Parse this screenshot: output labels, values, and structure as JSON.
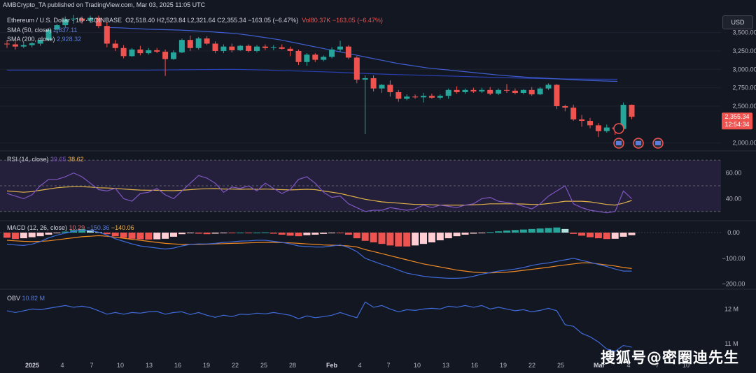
{
  "publish_line": "AMBCrypto_TA published on TradingView.com, Mar 03, 2025 11:05 UTC",
  "currency_button": "USD",
  "main_pane": {
    "symbol": "Ethereum / U.S. Dollar · 1D · COINBASE",
    "ohlc": "O2,518.40  H2,523.84  L2,321.64  C2,355.34  −163.05 (−6.47%)",
    "volume": "Vol80.37K  −163.05 (−6.47%)",
    "sma50_label": "SMA (50, close)",
    "sma50_value": "2,837.11",
    "sma200_label": "SMA (200, close)",
    "sma200_value": "2,928.32",
    "price_tag": "2,355.34",
    "countdown_tag": "12:54:34"
  },
  "rsi_pane": {
    "label": "RSI (14, close)",
    "value1": "39.65",
    "value2": "38.62"
  },
  "macd_pane": {
    "label": "MACD (12, 26, close)",
    "value1": "10.29",
    "value2": "−150.36",
    "value3": "−140.06"
  },
  "obv_pane": {
    "label": "OBV",
    "value": "10.82 M"
  },
  "watermark": "搜狐号@密圈迪先生",
  "colors": {
    "background": "#131722",
    "up": "#26a69a",
    "down": "#ef5350",
    "sma50": "#3f5fd1",
    "sma200": "#2a3fb0",
    "rsi": "#7e57c2",
    "rsi_ma": "#e0b34a",
    "macd": "#3f6ad8",
    "signal": "#f08a24",
    "obv": "#3f6ad8"
  },
  "chart_data": [
    {
      "type": "candlestick",
      "title": "Ethereum / U.S. Dollar · 1D · COINBASE",
      "y_ticks": [
        "3,500.00",
        "3,250.00",
        "3,000.00",
        "2,750.00",
        "2,500.00",
        "2,000.00"
      ],
      "ylim": [
        1930,
        3810
      ],
      "x_ticks": [
        "2025",
        "4",
        "7",
        "10",
        "13",
        "16",
        "19",
        "22",
        "25",
        "28",
        "Feb",
        "4",
        "7",
        "10",
        "13",
        "16",
        "19",
        "22",
        "25",
        "Mar",
        "4",
        "7",
        "10"
      ],
      "candles": [
        {
          "o": 3350,
          "h": 3400,
          "l": 3290,
          "c": 3340
        },
        {
          "o": 3340,
          "h": 3380,
          "l": 3270,
          "c": 3310
        },
        {
          "o": 3310,
          "h": 3360,
          "l": 3290,
          "c": 3330
        },
        {
          "o": 3330,
          "h": 3370,
          "l": 3300,
          "c": 3355
        },
        {
          "o": 3350,
          "h": 3420,
          "l": 3320,
          "c": 3400
        },
        {
          "o": 3400,
          "h": 3560,
          "l": 3390,
          "c": 3540
        },
        {
          "o": 3540,
          "h": 3620,
          "l": 3490,
          "c": 3600
        },
        {
          "o": 3600,
          "h": 3720,
          "l": 3560,
          "c": 3680
        },
        {
          "o": 3680,
          "h": 3740,
          "l": 3620,
          "c": 3690
        },
        {
          "o": 3690,
          "h": 3720,
          "l": 3620,
          "c": 3660
        },
        {
          "o": 3660,
          "h": 3730,
          "l": 3630,
          "c": 3700
        },
        {
          "o": 3700,
          "h": 3730,
          "l": 3560,
          "c": 3590
        },
        {
          "o": 3590,
          "h": 3640,
          "l": 3300,
          "c": 3350
        },
        {
          "o": 3350,
          "h": 3400,
          "l": 3250,
          "c": 3290
        },
        {
          "o": 3290,
          "h": 3330,
          "l": 3150,
          "c": 3180
        },
        {
          "o": 3180,
          "h": 3290,
          "l": 3170,
          "c": 3270
        },
        {
          "o": 3270,
          "h": 3320,
          "l": 3190,
          "c": 3220
        },
        {
          "o": 3220,
          "h": 3290,
          "l": 3200,
          "c": 3260
        },
        {
          "o": 3260,
          "h": 3290,
          "l": 3220,
          "c": 3240
        },
        {
          "o": 3240,
          "h": 3270,
          "l": 2910,
          "c": 3140
        },
        {
          "o": 3140,
          "h": 3260,
          "l": 3130,
          "c": 3230
        },
        {
          "o": 3230,
          "h": 3420,
          "l": 3220,
          "c": 3400
        },
        {
          "o": 3400,
          "h": 3460,
          "l": 3250,
          "c": 3290
        },
        {
          "o": 3290,
          "h": 3440,
          "l": 3270,
          "c": 3420
        },
        {
          "o": 3420,
          "h": 3450,
          "l": 3330,
          "c": 3350
        },
        {
          "o": 3350,
          "h": 3380,
          "l": 3220,
          "c": 3250
        },
        {
          "o": 3250,
          "h": 3340,
          "l": 3220,
          "c": 3310
        },
        {
          "o": 3310,
          "h": 3350,
          "l": 3230,
          "c": 3260
        },
        {
          "o": 3260,
          "h": 3330,
          "l": 3250,
          "c": 3320
        },
        {
          "o": 3320,
          "h": 3340,
          "l": 3230,
          "c": 3250
        },
        {
          "o": 3250,
          "h": 3330,
          "l": 3230,
          "c": 3310
        },
        {
          "o": 3310,
          "h": 3340,
          "l": 3260,
          "c": 3290
        },
        {
          "o": 3290,
          "h": 3330,
          "l": 3260,
          "c": 3300
        },
        {
          "o": 3300,
          "h": 3340,
          "l": 3270,
          "c": 3280
        },
        {
          "o": 3280,
          "h": 3310,
          "l": 3180,
          "c": 3250
        },
        {
          "o": 3250,
          "h": 3270,
          "l": 3060,
          "c": 3100
        },
        {
          "o": 3100,
          "h": 3220,
          "l": 3050,
          "c": 3200
        },
        {
          "o": 3200,
          "h": 3220,
          "l": 3100,
          "c": 3130
        },
        {
          "o": 3130,
          "h": 3190,
          "l": 3110,
          "c": 3170
        },
        {
          "o": 3170,
          "h": 3300,
          "l": 3150,
          "c": 3270
        },
        {
          "o": 3270,
          "h": 3390,
          "l": 3240,
          "c": 3310
        },
        {
          "o": 3310,
          "h": 3330,
          "l": 3140,
          "c": 3160
        },
        {
          "o": 3160,
          "h": 3180,
          "l": 2810,
          "c": 2860
        },
        {
          "o": 2860,
          "h": 2920,
          "l": 2120,
          "c": 2880
        },
        {
          "o": 2880,
          "h": 2920,
          "l": 2700,
          "c": 2740
        },
        {
          "o": 2740,
          "h": 2800,
          "l": 2680,
          "c": 2790
        },
        {
          "o": 2790,
          "h": 2850,
          "l": 2630,
          "c": 2690
        },
        {
          "o": 2690,
          "h": 2720,
          "l": 2560,
          "c": 2600
        },
        {
          "o": 2600,
          "h": 2660,
          "l": 2580,
          "c": 2630
        },
        {
          "o": 2630,
          "h": 2660,
          "l": 2600,
          "c": 2620
        },
        {
          "o": 2620,
          "h": 2680,
          "l": 2550,
          "c": 2640
        },
        {
          "o": 2640,
          "h": 2670,
          "l": 2600,
          "c": 2615
        },
        {
          "o": 2615,
          "h": 2660,
          "l": 2590,
          "c": 2640
        },
        {
          "o": 2640,
          "h": 2740,
          "l": 2600,
          "c": 2720
        },
        {
          "o": 2720,
          "h": 2770,
          "l": 2670,
          "c": 2690
        },
        {
          "o": 2690,
          "h": 2740,
          "l": 2670,
          "c": 2720
        },
        {
          "o": 2720,
          "h": 2750,
          "l": 2680,
          "c": 2700
        },
        {
          "o": 2700,
          "h": 2750,
          "l": 2680,
          "c": 2720
        },
        {
          "o": 2720,
          "h": 2760,
          "l": 2650,
          "c": 2670
        },
        {
          "o": 2670,
          "h": 2740,
          "l": 2650,
          "c": 2720
        },
        {
          "o": 2720,
          "h": 2800,
          "l": 2680,
          "c": 2710
        },
        {
          "o": 2710,
          "h": 2740,
          "l": 2660,
          "c": 2680
        },
        {
          "o": 2680,
          "h": 2730,
          "l": 2660,
          "c": 2720
        },
        {
          "o": 2720,
          "h": 2760,
          "l": 2640,
          "c": 2660
        },
        {
          "o": 2660,
          "h": 2760,
          "l": 2650,
          "c": 2740
        },
        {
          "o": 2740,
          "h": 2810,
          "l": 2720,
          "c": 2790
        },
        {
          "o": 2790,
          "h": 2800,
          "l": 2460,
          "c": 2500
        },
        {
          "o": 2500,
          "h": 2520,
          "l": 2430,
          "c": 2480
        },
        {
          "o": 2480,
          "h": 2520,
          "l": 2300,
          "c": 2320
        },
        {
          "o": 2320,
          "h": 2380,
          "l": 2220,
          "c": 2300
        },
        {
          "o": 2300,
          "h": 2340,
          "l": 2200,
          "c": 2240
        },
        {
          "o": 2240,
          "h": 2270,
          "l": 2080,
          "c": 2160
        },
        {
          "o": 2160,
          "h": 2250,
          "l": 2140,
          "c": 2210
        },
        {
          "o": 2210,
          "h": 2230,
          "l": 2110,
          "c": 2190
        },
        {
          "o": 2190,
          "h": 2550,
          "l": 2180,
          "c": 2518
        },
        {
          "o": 2518.4,
          "h": 2523.84,
          "l": 2321.64,
          "c": 2355.34
        }
      ],
      "sma50": [
        3570,
        3565,
        3555,
        3545,
        3540,
        3535,
        3525,
        3515,
        3500,
        3485,
        3460,
        3430,
        3400,
        3360,
        3320,
        3280,
        3240,
        3200,
        3160,
        3120,
        3080,
        3050,
        3020,
        3000,
        2980,
        2960,
        2940,
        2920,
        2905,
        2890,
        2880,
        2870,
        2860,
        2850,
        2842,
        2837
      ],
      "sma200": [
        2990,
        2990,
        2990,
        2990,
        2990,
        2990,
        2990,
        2990,
        2990,
        2992,
        2994,
        2996,
        2998,
        3000,
        2995,
        2990,
        2982,
        2975,
        2968,
        2960,
        2950,
        2940,
        2932,
        2925,
        2918,
        2912,
        2905,
        2898,
        2890,
        2884,
        2878,
        2874,
        2870,
        2868,
        2866,
        2865
      ]
    },
    {
      "type": "line",
      "title": "RSI (14, close)",
      "y_ticks": [
        "60.00",
        "40.00"
      ],
      "ylim": [
        25,
        75
      ],
      "bands": [
        30,
        70
      ],
      "series": [
        {
          "name": "RSI",
          "values": [
            44,
            42,
            40,
            43,
            50,
            55,
            55,
            57,
            60,
            57,
            52,
            47,
            46,
            48,
            40,
            38,
            44,
            45,
            48,
            43,
            40,
            46,
            52,
            58,
            56,
            52,
            45,
            49,
            48,
            50,
            46,
            52,
            48,
            44,
            47,
            55,
            57,
            52,
            45,
            41,
            42,
            36,
            33,
            30,
            31,
            31,
            33,
            32,
            31,
            32,
            35,
            33,
            35,
            34,
            33,
            35,
            36,
            40,
            41,
            38,
            37,
            36,
            34,
            32,
            36,
            42,
            46,
            50,
            36,
            33,
            31,
            30,
            29,
            30,
            46,
            40
          ]
        },
        {
          "name": "RSI MA",
          "values": [
            46,
            45.5,
            45,
            45.5,
            46.5,
            47.5,
            48.5,
            49,
            49.3,
            49.3,
            49,
            48.5,
            48.3,
            48,
            47.5,
            47,
            46.7,
            46.5,
            46.5,
            46.3,
            46.2,
            46.5,
            47,
            47.5,
            47.7,
            47.8,
            47.5,
            47.5,
            47.3,
            47.5,
            47.3,
            47.5,
            47.3,
            47,
            46.8,
            47,
            47.3,
            47,
            46,
            45,
            44,
            42.5,
            41,
            39.5,
            38.5,
            37.5,
            37,
            36.5,
            36,
            35.5,
            35.5,
            35.2,
            35,
            35,
            35,
            35,
            35.2,
            35.5,
            36,
            36,
            36,
            36,
            35.8,
            35.5,
            35.5,
            36.2,
            37,
            38,
            38,
            38,
            37.5,
            36.5,
            35.5,
            35,
            36.5,
            38.6
          ]
        }
      ]
    },
    {
      "type": "bar",
      "title": "MACD (12, 26, close)",
      "y_ticks": [
        "0.00",
        "−100.00",
        "−200.00"
      ],
      "ylim": [
        -215,
        30
      ],
      "histogram": [
        -20,
        -25,
        -22,
        -18,
        -14,
        -8,
        -2,
        4,
        10,
        14,
        10,
        2,
        -6,
        -14,
        -20,
        -24,
        -26,
        -27,
        -26,
        -24,
        -16,
        -6,
        -2,
        -4,
        -6,
        -4,
        -2,
        -2,
        0,
        -2,
        0,
        1,
        -4,
        -8,
        -12,
        -14,
        -10,
        -8,
        -5,
        -2,
        -2,
        -8,
        -22,
        -32,
        -38,
        -44,
        -50,
        -54,
        -54,
        -50,
        -44,
        -38,
        -30,
        -22,
        -14,
        -8,
        -4,
        -2,
        2,
        5,
        8,
        10,
        12,
        14,
        16,
        18,
        20,
        14,
        -5,
        -12,
        -18,
        -22,
        -25,
        -24,
        -16,
        -10
      ],
      "series": [
        {
          "name": "MACD",
          "values": [
            -45,
            -48,
            -50,
            -45,
            -35,
            -20,
            -10,
            -2,
            5,
            10,
            8,
            2,
            -10,
            -24,
            -34,
            -44,
            -52,
            -56,
            -60,
            -64,
            -60,
            -52,
            -46,
            -44,
            -44,
            -42,
            -38,
            -36,
            -33,
            -32,
            -30,
            -30,
            -34,
            -38,
            -44,
            -52,
            -54,
            -56,
            -56,
            -52,
            -48,
            -58,
            -74,
            -100,
            -112,
            -124,
            -134,
            -146,
            -158,
            -164,
            -170,
            -174,
            -176,
            -178,
            -178,
            -176,
            -170,
            -162,
            -156,
            -150,
            -146,
            -142,
            -136,
            -128,
            -122,
            -118,
            -112,
            -106,
            -100,
            -108,
            -116,
            -124,
            -132,
            -142,
            -150,
            -150
          ]
        },
        {
          "name": "Signal",
          "values": [
            -30,
            -32,
            -34,
            -35,
            -34,
            -32,
            -28,
            -24,
            -20,
            -16,
            -14,
            -12,
            -14,
            -18,
            -22,
            -26,
            -30,
            -34,
            -38,
            -42,
            -44,
            -46,
            -46,
            -46,
            -45,
            -44,
            -43,
            -42,
            -41,
            -40,
            -39,
            -38,
            -38,
            -39,
            -40,
            -42,
            -44,
            -46,
            -48,
            -49,
            -50,
            -52,
            -56,
            -66,
            -74,
            -82,
            -90,
            -98,
            -106,
            -114,
            -122,
            -128,
            -134,
            -140,
            -146,
            -150,
            -154,
            -156,
            -157,
            -156,
            -154,
            -151,
            -147,
            -143,
            -139,
            -135,
            -130,
            -126,
            -122,
            -118,
            -118,
            -122,
            -126,
            -130,
            -136,
            -140
          ]
        }
      ]
    },
    {
      "type": "line",
      "title": "OBV",
      "y_ticks": [
        "12 M",
        "11 M"
      ],
      "ylim": [
        10.6,
        12.45
      ],
      "series": [
        {
          "name": "OBV",
          "values": [
            11.95,
            11.9,
            11.95,
            12.0,
            11.98,
            12.02,
            12.06,
            12.1,
            12.05,
            12.08,
            12.04,
            11.95,
            11.85,
            11.9,
            11.85,
            11.9,
            11.88,
            11.92,
            11.93,
            11.85,
            11.9,
            11.92,
            11.84,
            11.9,
            11.82,
            11.76,
            11.82,
            11.78,
            11.85,
            11.84,
            11.88,
            11.86,
            11.9,
            11.86,
            11.82,
            11.72,
            11.8,
            11.75,
            11.78,
            11.82,
            11.9,
            11.82,
            11.75,
            12.2,
            12.05,
            12.1,
            12.0,
            11.92,
            11.98,
            11.96,
            12.0,
            12.02,
            12.0,
            12.08,
            12.05,
            12.1,
            12.05,
            12.1,
            12.0,
            12.05,
            12.0,
            11.95,
            11.98,
            11.92,
            11.96,
            12.02,
            11.95,
            11.55,
            11.5,
            11.3,
            11.2,
            11.05,
            10.85,
            10.78,
            10.95,
            10.9
          ]
        }
      ]
    }
  ]
}
